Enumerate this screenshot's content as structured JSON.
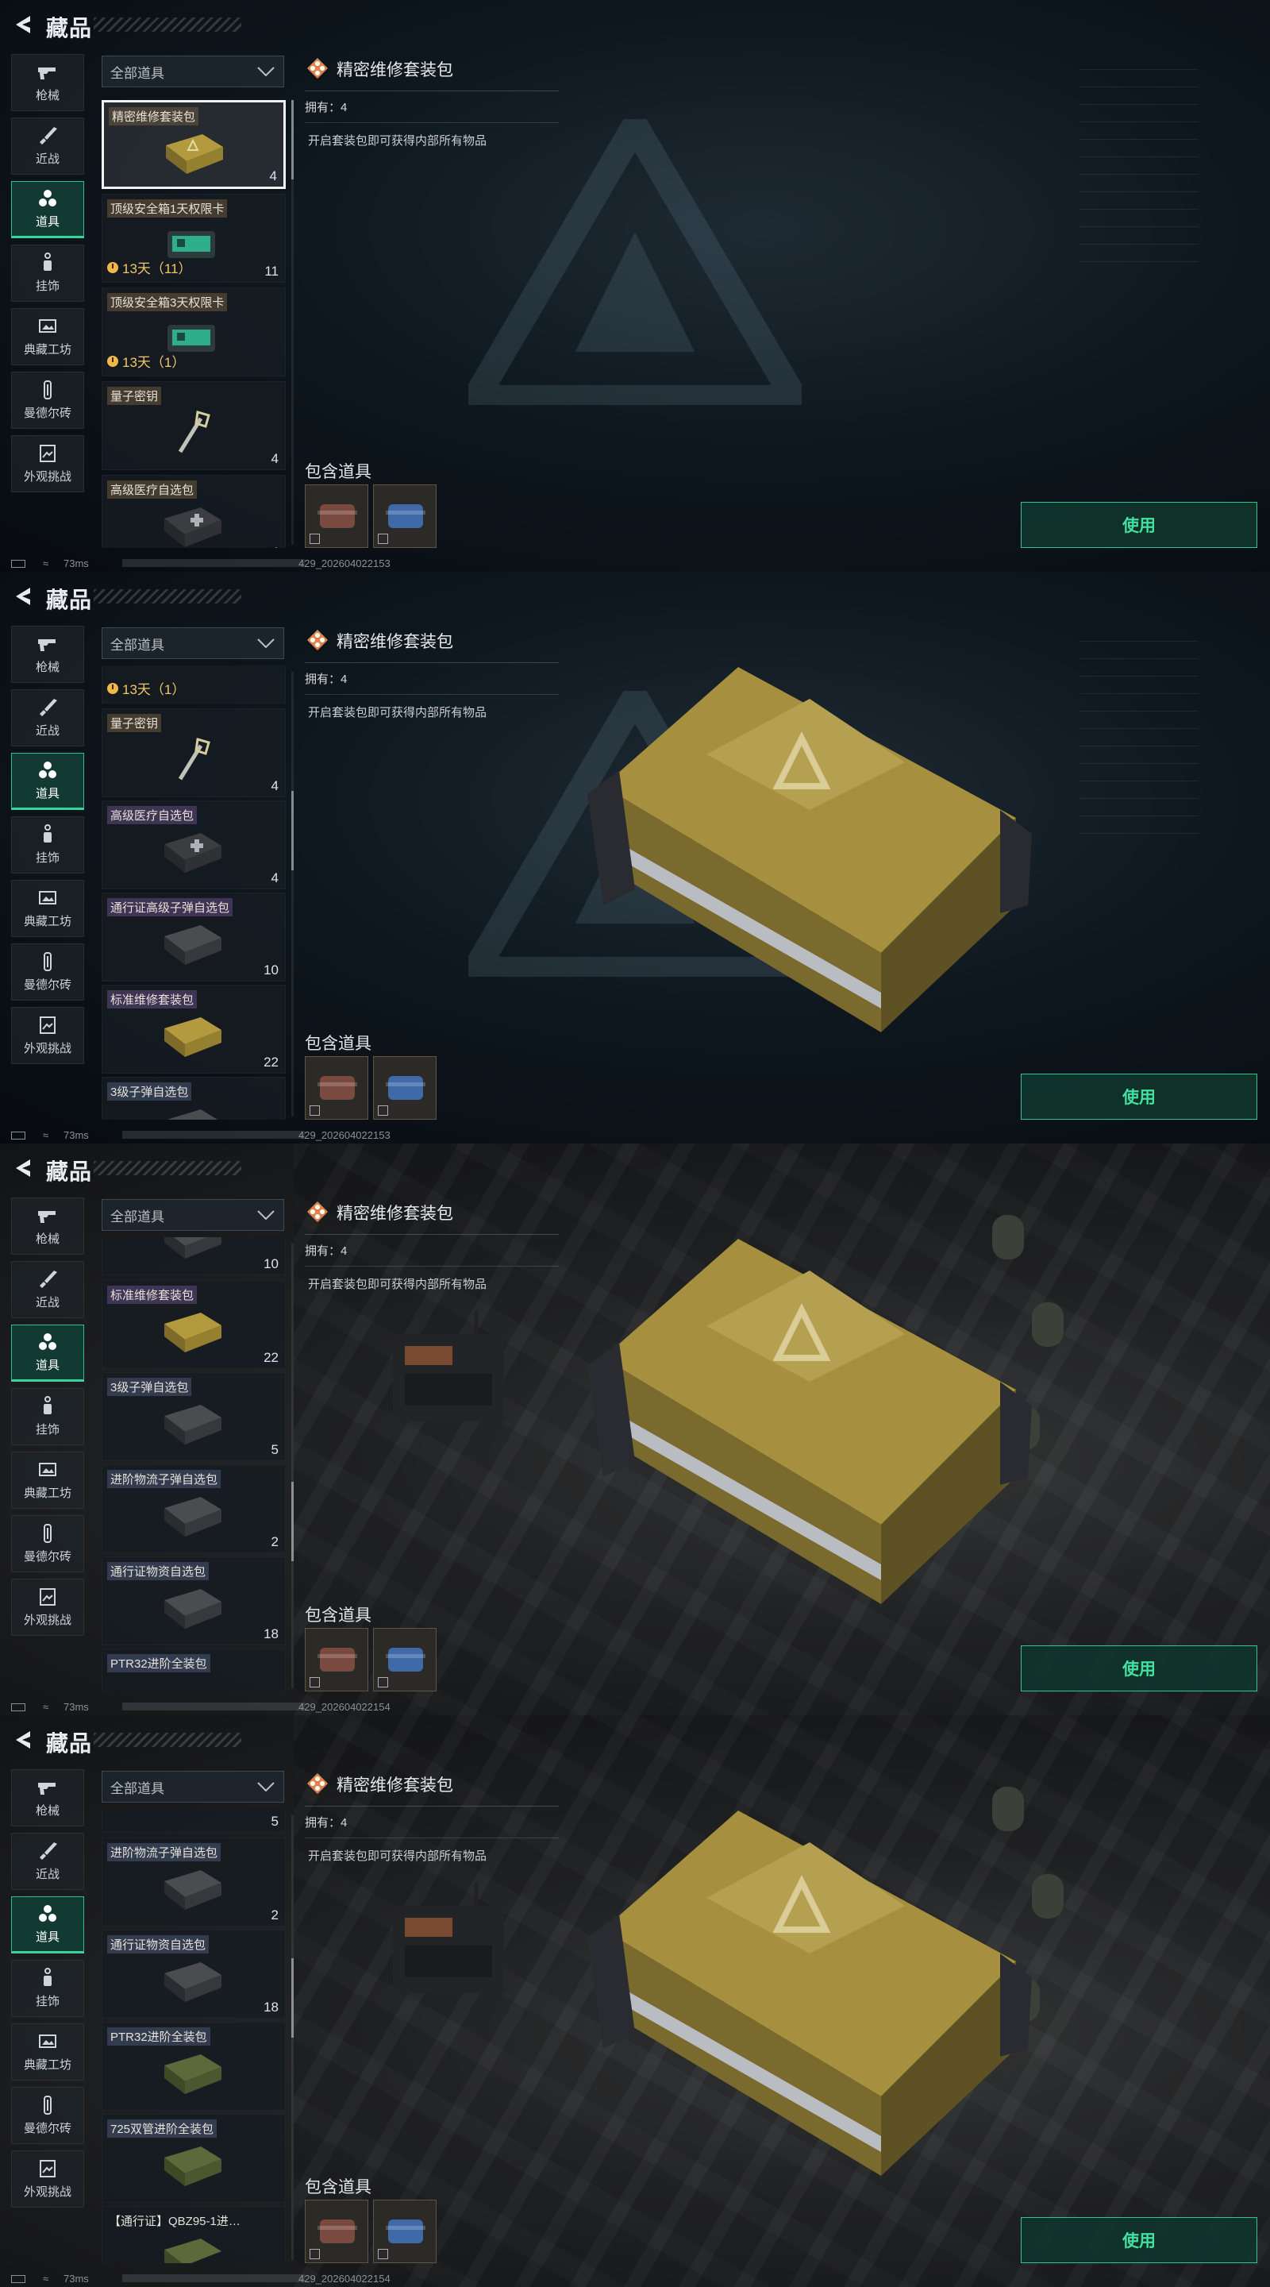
{
  "header": {
    "title": "藏品"
  },
  "sidebar": {
    "items": [
      {
        "label": "枪械",
        "icon": "gun-icon"
      },
      {
        "label": "近战",
        "icon": "knife-icon"
      },
      {
        "label": "道具",
        "icon": "items-icon",
        "active": true
      },
      {
        "label": "挂饰",
        "icon": "charm-icon"
      },
      {
        "label": "典藏工坊",
        "icon": "workshop-icon"
      },
      {
        "label": "曼德尔砖",
        "icon": "brick-icon"
      },
      {
        "label": "外观挑战",
        "icon": "challenge-icon"
      }
    ]
  },
  "filter": {
    "label": "全部道具"
  },
  "items": {
    "i0": {
      "name": "精密维修套装包",
      "qty": "4"
    },
    "i1": {
      "name": "顶级安全箱1天权限卡",
      "qty": "11",
      "timer": "13天（11）"
    },
    "i2": {
      "name": "顶级安全箱3天权限卡",
      "timer": "13天（1）"
    },
    "i3": {
      "name": "量子密钥",
      "qty": "4"
    },
    "i4": {
      "name": "高级医疗自选包",
      "qty": "4"
    },
    "i5": {
      "name": "通行证高级子弹自选包",
      "qty": "10"
    },
    "i6": {
      "name": "标准维修套装包",
      "qty": "22"
    },
    "i7": {
      "name": "3级子弹自选包",
      "qty": "5"
    },
    "i8": {
      "name": "进阶物流子弹自选包",
      "qty": "2"
    },
    "i9": {
      "name": "通行证物资自选包",
      "qty": "18"
    },
    "i10": {
      "name": "PTR32进阶全装包"
    },
    "i11": {
      "name": "725双管进阶全装包"
    },
    "i12": {
      "name": "【通行证】QBZ95-1进…"
    },
    "i13": {
      "name": "PTR32进阶全装包"
    }
  },
  "detail": {
    "name": "精密维修套装包",
    "owned": "拥有：4",
    "description": "开启套装包即可获得内部所有物品",
    "contains_label": "包含道具",
    "use_label": "使用"
  },
  "status": {
    "ping": "73ms",
    "uids": [
      "429_202604022153",
      "429_202604022153",
      "429_202604022154",
      "429_202604022154"
    ]
  },
  "colors": {
    "accent": "#39d49a",
    "use_text": "#43e0a2",
    "timer": "#f0c868"
  }
}
